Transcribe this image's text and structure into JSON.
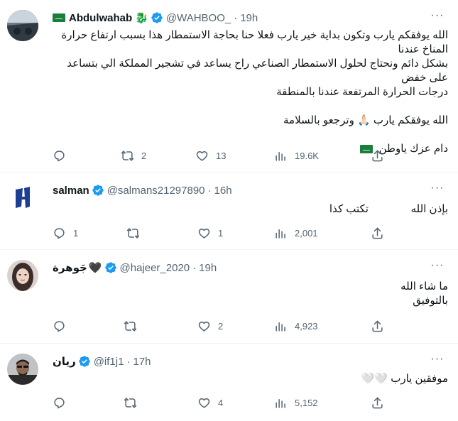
{
  "tweets": [
    {
      "name": "Abdulwahab",
      "name_emoji": "🐉",
      "handle": "@WAHBOO_",
      "time": "19h",
      "lines": [
        "الله يوفقكم يارب وتكون بداية خير يارب فعلا حنا بحاجة الاستمطار هذا بسبب ارتفاع حرارة المناخ عندنا",
        "بشكل دائم ونحتاج لحلول الاستمطار الصناعي راح يساعد في تشجير المملكة الي بتساعد على خفض",
        "درجات الحرارة المرتفعة عندنا بالمنطقة",
        "",
        "الله يوفقكم يارب 🙏🏻 وترجعو بالسلامة",
        "",
        "دام عزك ياوطن"
      ],
      "stats": {
        "replies": "",
        "reposts": "2",
        "likes": "13",
        "views": "19.6K"
      }
    },
    {
      "name": "salman",
      "handle": "@salmans21297890",
      "time": "16h",
      "line_right": "بإذن الله",
      "line_left": "تكتب كذا",
      "stats": {
        "replies": "1",
        "reposts": "",
        "likes": "1",
        "views": "2,001"
      }
    },
    {
      "name": "جَوهرة",
      "name_emoji": "🖤",
      "handle": "@hajeer_2020",
      "time": "19h",
      "lines": [
        "ما شاء الله",
        "بالتوفيق"
      ],
      "stats": {
        "replies": "",
        "reposts": "",
        "likes": "2",
        "views": "4,923"
      }
    },
    {
      "name": "ريان",
      "handle": "@if1j1",
      "time": "17h",
      "lines": [
        "موفقين يارب 🤍🤍"
      ],
      "stats": {
        "replies": "",
        "reposts": "",
        "likes": "4",
        "views": "5,152"
      }
    }
  ],
  "icons": {
    "reply": "reply-icon",
    "repost": "repost-icon",
    "like": "heart-icon",
    "views": "views-icon",
    "share": "share-icon",
    "more": "more-icon",
    "verified": "verified-badge-icon"
  },
  "colors": {
    "verified": "#1d9bf0",
    "secondary_text": "#536471",
    "flag": "#1a7f3c"
  }
}
